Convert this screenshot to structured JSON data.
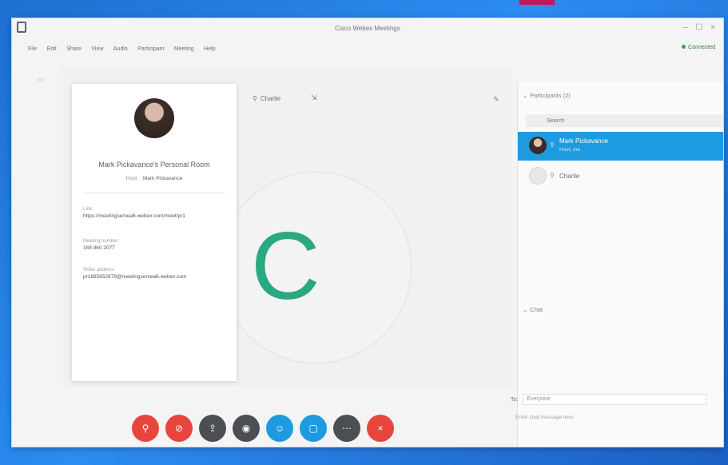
{
  "window": {
    "title": "Cisco Webex Meetings",
    "controls": [
      "–",
      "☐",
      "×"
    ]
  },
  "menu": [
    "File",
    "Edit",
    "Share",
    "View",
    "Audio",
    "Participant",
    "Meeting",
    "Help"
  ],
  "status": {
    "connected": "Connected"
  },
  "stage": {
    "avatar_letter": "C",
    "active_user": "Charlie",
    "accent_color": "#2aa882"
  },
  "info_card": {
    "room_title": "Mark Pickavance's Personal Room",
    "host_label": "Host:",
    "host_name": "Mark Pickavance",
    "link_label": "Link:",
    "link_value": "https://meetingsemea6.webex.com/meet/pr1",
    "meeting_number_label": "Meeting number:",
    "meeting_number_value": "168 960 2077",
    "video_address_label": "Video address:",
    "video_address_value": "pr1685652879@meetingsemea6.webex.com"
  },
  "controls": [
    {
      "name": "mute-button",
      "color": "red",
      "icon": "mic-off-icon",
      "glyph": "⚲"
    },
    {
      "name": "stop-video-button",
      "color": "red",
      "icon": "video-off-icon",
      "glyph": "⊘"
    },
    {
      "name": "share-button",
      "color": "dark",
      "icon": "share-icon",
      "glyph": "⇪"
    },
    {
      "name": "record-button",
      "color": "dark",
      "icon": "record-icon",
      "glyph": "◉"
    },
    {
      "name": "participants-button",
      "color": "blue",
      "icon": "participants-icon",
      "glyph": "☺"
    },
    {
      "name": "chat-button",
      "color": "blue",
      "icon": "chat-icon",
      "glyph": "▢"
    },
    {
      "name": "more-button",
      "color": "dark",
      "icon": "more-icon",
      "glyph": "⋯"
    },
    {
      "name": "end-meeting-button",
      "color": "red",
      "icon": "close-icon",
      "glyph": "×"
    }
  ],
  "participants_panel": {
    "header": "Participants (2)",
    "search_placeholder": "Search",
    "people": [
      {
        "name": "Mark Pickavance",
        "role": "Host, me",
        "selected": true
      },
      {
        "name": "Charlie",
        "role": "",
        "selected": false
      }
    ]
  },
  "chat_panel": {
    "header": "Chat",
    "to_label": "To:",
    "to_value": "Everyone",
    "input_placeholder": "Enter chat message here"
  }
}
